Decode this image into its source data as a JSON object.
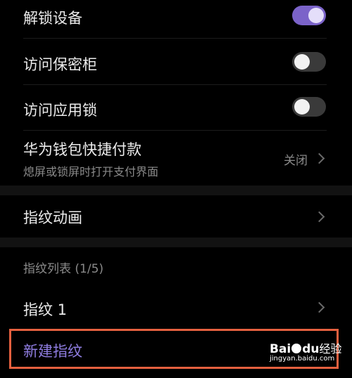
{
  "settings": {
    "unlock_device": {
      "label": "解锁设备",
      "toggle": "on"
    },
    "access_safe": {
      "label": "访问保密柜",
      "toggle": "off"
    },
    "access_app_lock": {
      "label": "访问应用锁",
      "toggle": "off"
    },
    "huawei_wallet": {
      "label": "华为钱包快捷付款",
      "sublabel": "熄屏或锁屏时打开支付界面",
      "value": "关闭"
    },
    "fingerprint_animation": {
      "label": "指纹动画"
    }
  },
  "fingerprint_list": {
    "title": "指纹列表 (1/5)",
    "items": [
      {
        "label": "指纹 1"
      }
    ],
    "new_label": "新建指纹"
  },
  "watermark": {
    "logo_text_left": "Bai",
    "logo_text_right": "du",
    "logo_suffix": "经验",
    "url": "jingyan.baidu.com"
  },
  "colors": {
    "accent": "#7b63c9",
    "highlight": "#e5603f",
    "background": "#000000"
  }
}
